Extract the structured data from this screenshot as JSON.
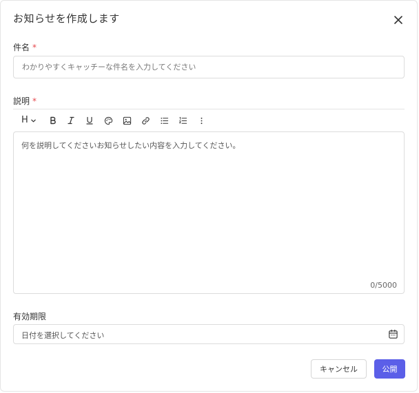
{
  "dialog": {
    "title": "お知らせを作成します"
  },
  "subject": {
    "label": "件名",
    "required_mark": "*",
    "placeholder": "わかりやすくキャッチーな件名を入力してください",
    "value": ""
  },
  "description": {
    "label": "説明",
    "required_mark": "*",
    "toolbar": {
      "heading_label": "H",
      "items": [
        "heading-dropdown",
        "bold",
        "italic",
        "underline",
        "text-color",
        "image",
        "link",
        "bullet-list",
        "numbered-list",
        "more"
      ]
    },
    "placeholder": "何を説明してくださいお知らせしたい内容を入力してください。",
    "char_count": "0/5000"
  },
  "expiry": {
    "label": "有効期限",
    "placeholder": "日付を選択してください"
  },
  "footer": {
    "cancel_label": "キャンセル",
    "publish_label": "公開"
  },
  "colors": {
    "accent": "#5b5fe8",
    "required": "#e5484d",
    "border": "#dcdcdc"
  }
}
